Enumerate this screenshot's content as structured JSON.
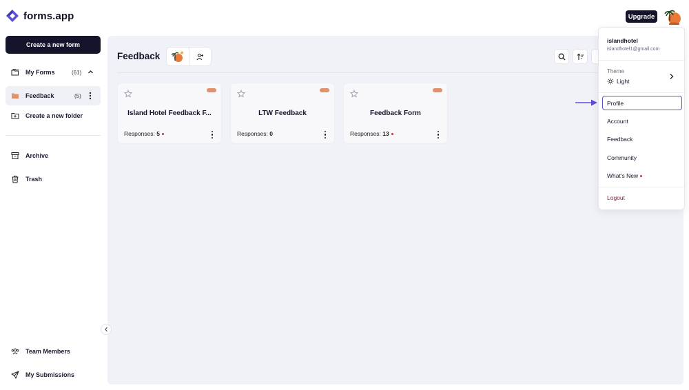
{
  "brand": {
    "name": "forms.app",
    "accent": "#5b50d6",
    "dark": "#14152a"
  },
  "topbar": {
    "upgrade_label": "Upgrade"
  },
  "sidebar": {
    "create_label": "Create a new form",
    "my_forms": {
      "label": "My Forms",
      "count": "(61)"
    },
    "feedback": {
      "label": "Feedback",
      "count": "(5)"
    },
    "new_folder_label": "Create a new folder",
    "archive_label": "Archive",
    "trash_label": "Trash",
    "team_label": "Team Members",
    "submissions_label": "My Submissions"
  },
  "main": {
    "title": "Feedback",
    "cards": [
      {
        "title": "Island Hotel Feedback F...",
        "responses_label": "Responses:",
        "responses": "5",
        "new": true
      },
      {
        "title": "LTW Feedback",
        "responses_label": "Responses:",
        "responses": "0",
        "new": false
      },
      {
        "title": "Feedback Form",
        "responses_label": "Responses:",
        "responses": "13",
        "new": true
      }
    ]
  },
  "dropdown": {
    "username": "islandhotel",
    "email": "islandhotel1@gmail.com",
    "theme_label": "Theme",
    "theme_value": "Light",
    "items": {
      "profile": "Profile",
      "account": "Account",
      "feedback": "Feedback",
      "community": "Community",
      "whats_new": "What's New",
      "logout": "Logout"
    }
  }
}
